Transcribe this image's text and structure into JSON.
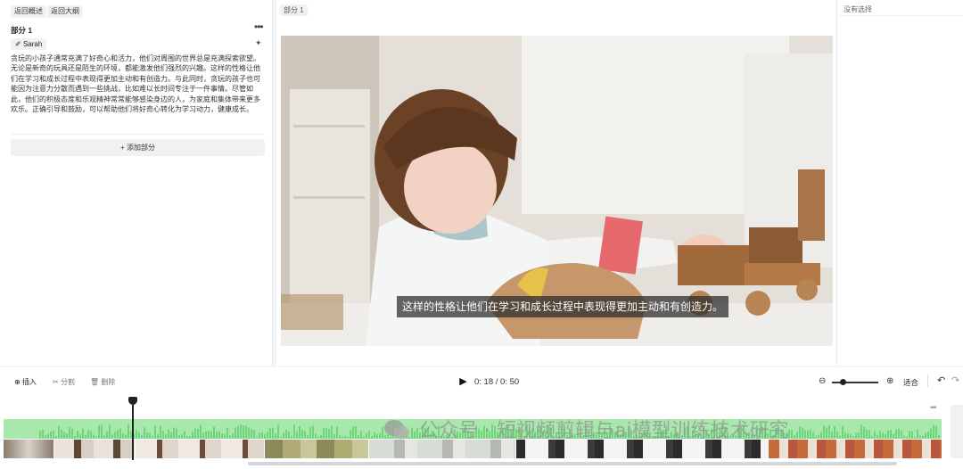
{
  "left_panel": {
    "back_overview": "返回概述",
    "back_outline": "返回大纲",
    "section_title": "部分 1",
    "more": "•••",
    "speaker": "Sarah",
    "paragraph": "贪玩的小孩子通常充满了好奇心和活力，他们对周围的世界总是充满探索欲望。无论是新奇的玩具还是陌生的环境，都能激发他们强烈的兴趣。这样的性格让他们在学习和成长过程中表现得更加主动和有创造力。与此同时，贪玩的孩子也可能因为注意力分散而遇到一些挑战，比如难以长时间专注于一件事情。尽管如此，他们的积极态度和乐观精神常常能够感染身边的人，为家庭和集体带来更多欢乐。正确引导和鼓励，可以帮助他们将好奇心转化为学习动力，健康成长。",
    "add_section": "+ 添加部分"
  },
  "center_panel": {
    "tab": "部分 1",
    "subtitle": "这样的性格让他们在学习和成长过程中表现得更加主动和有创造力。"
  },
  "right_panel": {
    "title": "没有选择"
  },
  "timeline": {
    "insert": "插入",
    "split": "分割",
    "delete": "删除",
    "time": "0: 18 / 0: 50",
    "fit": "适合",
    "more": "•••"
  },
  "watermark": "公众号 · 短视频剪辑与ai模型训练技术研究",
  "colors": {
    "audio_track": "#a8e8ad",
    "panel_bg": "#ffffff",
    "app_bg": "#f4f5f7"
  }
}
